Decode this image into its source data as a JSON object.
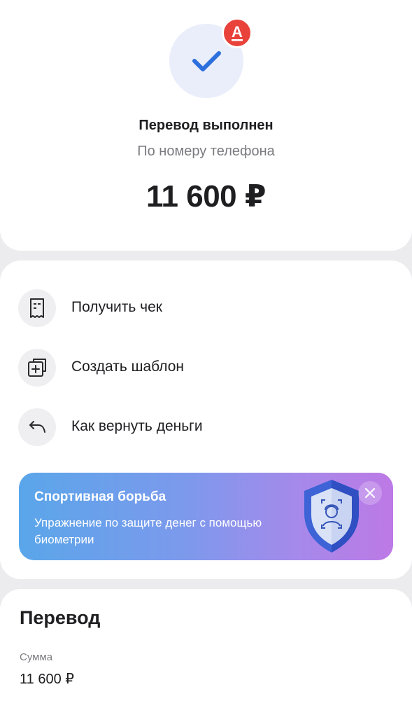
{
  "colors": {
    "accent_blue": "#2d6fdc",
    "bank_red": "#e8423a",
    "page_bg": "#ececef",
    "promo_gradient_start": "#5aa6ea",
    "promo_gradient_end": "#bd79e6"
  },
  "status": {
    "icon": "checkmark-icon",
    "bank_badge_icon": "alfa-bank-logo",
    "bank_badge_letter": "А",
    "title": "Перевод выполнен",
    "subtitle": "По номеру телефона",
    "amount": "11 600 ₽"
  },
  "actions": [
    {
      "icon": "receipt-icon",
      "label": "Получить чек"
    },
    {
      "icon": "add-template-icon",
      "label": "Создать шаблон"
    },
    {
      "icon": "return-arrow-icon",
      "label": "Как вернуть деньги"
    }
  ],
  "promo": {
    "title": "Спортивная борьба",
    "text": "Упражнение по защите денег с помощью биометрии",
    "illustration": "biometric-shield-icon",
    "close_icon": "close-icon"
  },
  "details": {
    "title": "Перевод",
    "amount_label": "Сумма",
    "amount_value": "11 600 ₽"
  }
}
